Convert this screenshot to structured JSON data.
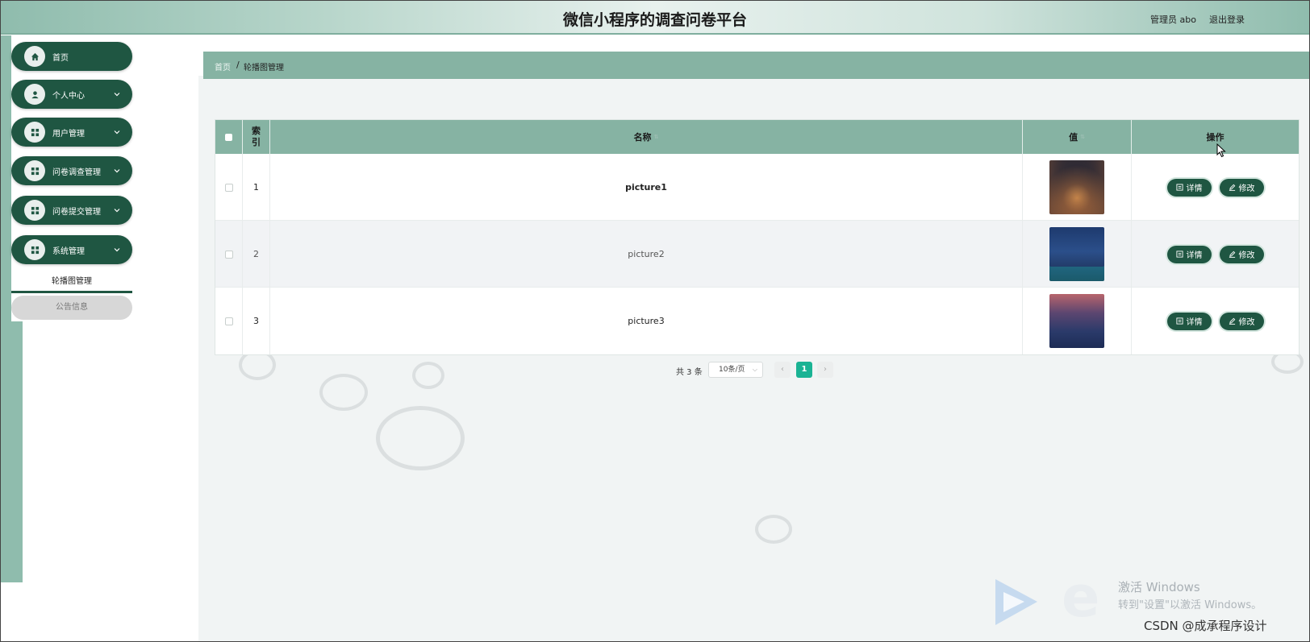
{
  "header": {
    "title": "微信小程序的调查问卷平台",
    "user": "管理员 abo",
    "logout": "退出登录"
  },
  "sidebar": {
    "items": [
      {
        "label": "首页",
        "icon": "home-icon",
        "expandable": false
      },
      {
        "label": "个人中心",
        "icon": "user-icon",
        "expandable": true
      },
      {
        "label": "用户管理",
        "icon": "grid-icon",
        "expandable": true
      },
      {
        "label": "问卷调查管理",
        "icon": "grid-icon",
        "expandable": true
      },
      {
        "label": "问卷提交管理",
        "icon": "grid-icon",
        "expandable": true
      },
      {
        "label": "系统管理",
        "icon": "grid-icon",
        "expandable": true
      }
    ],
    "submenu": {
      "active": "轮播图管理",
      "other": "公告信息"
    }
  },
  "breadcrumb": {
    "home": "首页",
    "separator": "/",
    "current": "轮播图管理"
  },
  "table": {
    "columns": {
      "index": "索引",
      "name": "名称",
      "value": "值",
      "actions": "操作"
    },
    "rows": [
      {
        "index": "1",
        "name": "picture1",
        "thumb": "city-night-tower"
      },
      {
        "index": "2",
        "name": "picture2",
        "thumb": "bridge-blue-night"
      },
      {
        "index": "3",
        "name": "picture3",
        "thumb": "city-sunset-river"
      }
    ],
    "buttons": {
      "detail": "详情",
      "edit": "修改"
    }
  },
  "pagination": {
    "total": "共 3 条",
    "page_size": "10条/页",
    "current_page": "1",
    "prev": "‹",
    "next": "›"
  },
  "watermark": {
    "activate_title": "激活 Windows",
    "activate_sub": "转到\"设置\"以激活 Windows。",
    "csdn": "CSDN @成承程序设计"
  },
  "colors": {
    "primary": "#1f5642",
    "header_accent": "#86b3a3",
    "page_active": "#1ab394"
  }
}
